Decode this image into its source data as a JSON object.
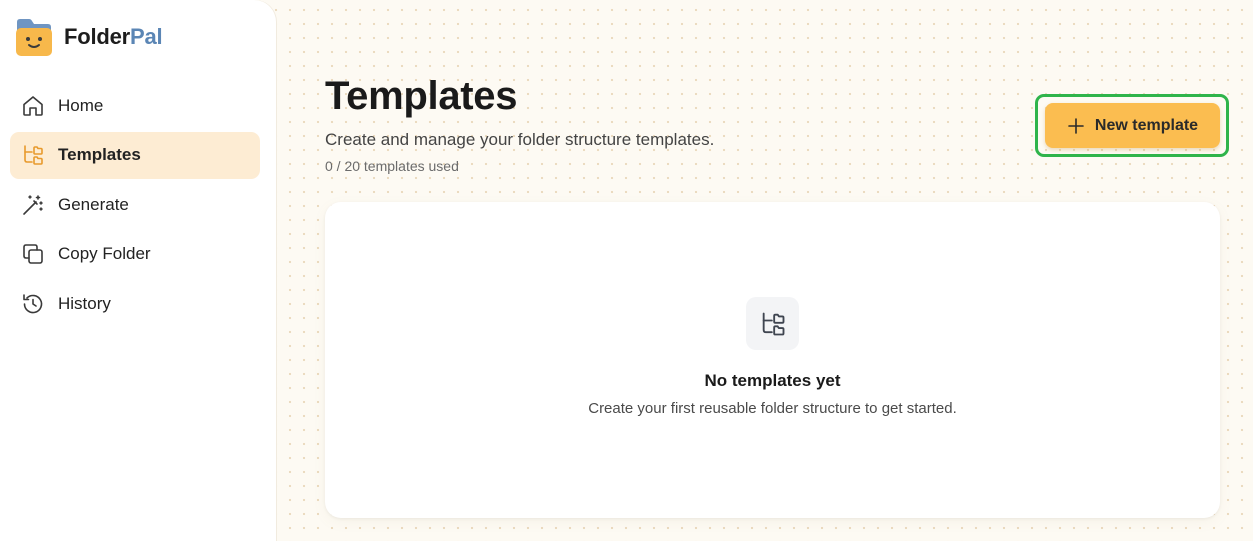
{
  "brand": {
    "name_part1": "Folder",
    "name_part2": "Pal",
    "accent": "#5b86b5"
  },
  "sidebar": {
    "items": [
      {
        "label": "Home",
        "icon": "home-icon",
        "active": false
      },
      {
        "label": "Templates",
        "icon": "folder-tree-icon",
        "active": true
      },
      {
        "label": "Generate",
        "icon": "magic-wand-icon",
        "active": false
      },
      {
        "label": "Copy Folder",
        "icon": "copy-icon",
        "active": false
      },
      {
        "label": "History",
        "icon": "history-icon",
        "active": false
      }
    ]
  },
  "main": {
    "title": "Templates",
    "subtitle": "Create and manage your folder structure templates.",
    "usage": "0 / 20 templates used",
    "new_button_label": "New template",
    "empty": {
      "icon": "folder-tree-icon",
      "title": "No templates yet",
      "description": "Create your first reusable folder structure to get started."
    }
  },
  "colors": {
    "button": "#fbbd50",
    "highlight": "#2fb44b",
    "active_nav": "#fdecd3"
  }
}
